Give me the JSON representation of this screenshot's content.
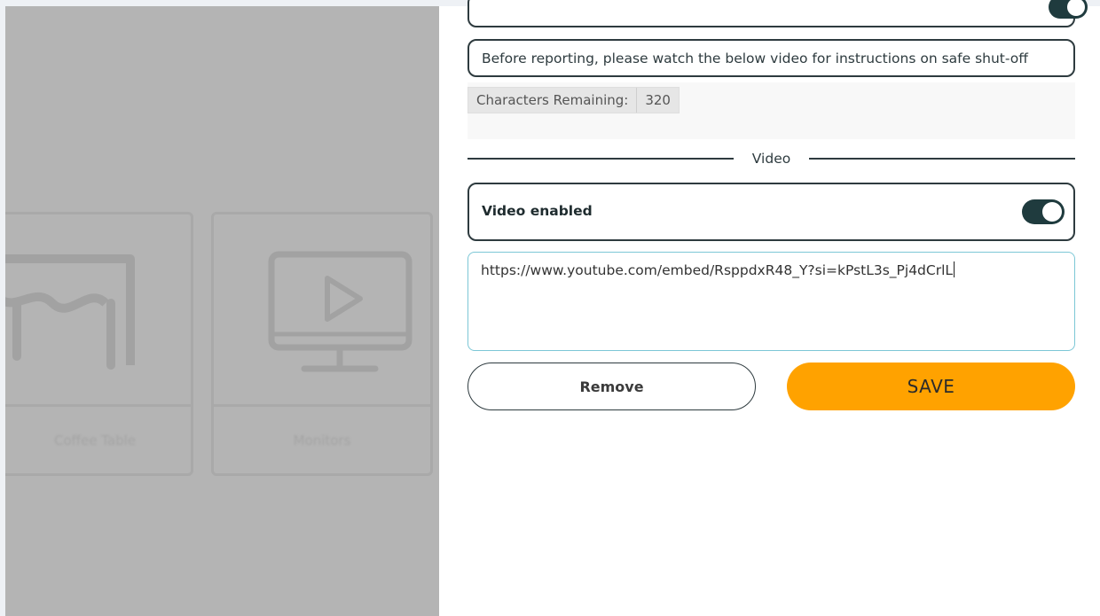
{
  "background": {
    "cards": [
      {
        "label": "Coffee Table",
        "icon": "table-icon"
      },
      {
        "label": "Monitors",
        "icon": "monitor-play-icon"
      }
    ]
  },
  "form": {
    "message_text": "Before reporting, please watch the below video for instructions on safe shut-off",
    "characters_remaining_label": "Characters Remaining:",
    "characters_remaining_value": "320",
    "section_title": "Video",
    "video_enabled_label": "Video enabled",
    "video_enabled": true,
    "video_url": "https://www.youtube.com/embed/RsppdxR48_Y?si=kPstL3s_Pj4dCrlL"
  },
  "actions": {
    "remove_label": "Remove",
    "save_label": "SAVE"
  },
  "colors": {
    "accent": "#ffa200",
    "dark": "#1f3b3e",
    "focus_border": "#7cc7d6"
  }
}
